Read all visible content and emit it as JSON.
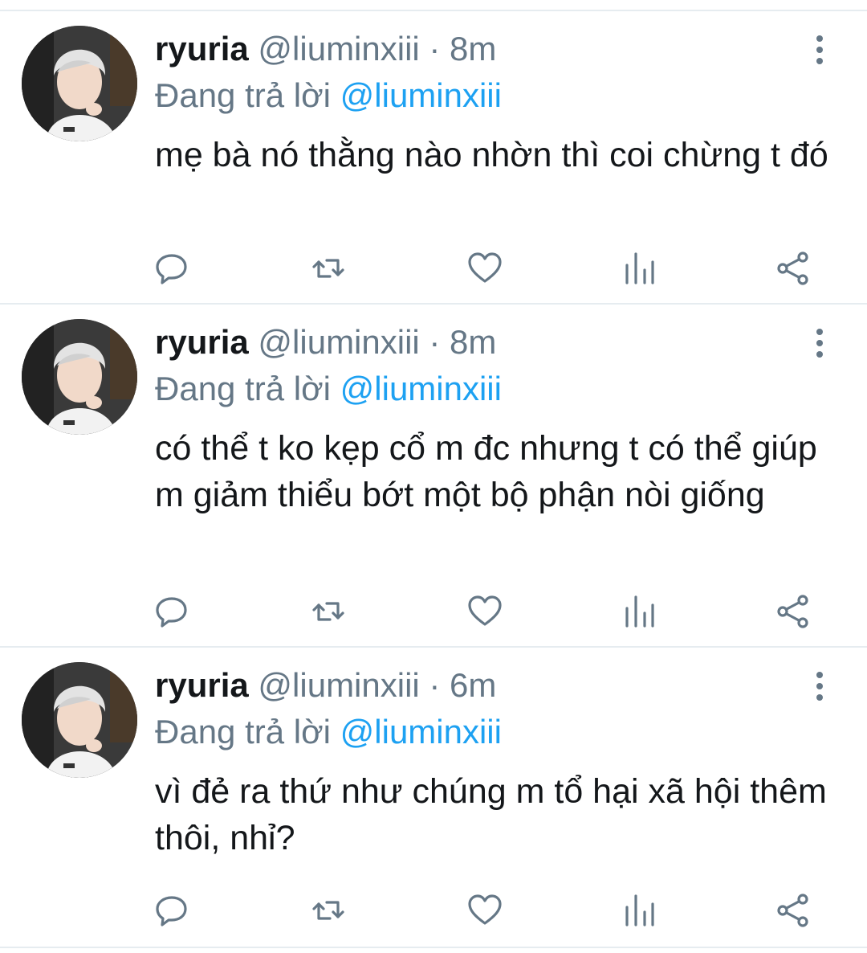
{
  "colors": {
    "text": "#14171a",
    "secondary": "#657786",
    "accent": "#1da1f2",
    "divider": "#e6ecf0",
    "icon": "#657786"
  },
  "icons": {
    "reply": "speech-bubble",
    "retweet": "two-arrows-loop",
    "like": "heart-outline",
    "stats": "bar-chart",
    "share": "share-nodes",
    "more": "vertical-dots"
  },
  "tweets": [
    {
      "display_name": "ryuria",
      "handle_time": "@liuminxiii · 8m",
      "replying_prefix": "Đang trả lời",
      "replying_to": "@liuminxiii",
      "text": "mẹ bà nó thằng nào nhờn thì coi chừng t đó"
    },
    {
      "display_name": "ryuria",
      "handle_time": "@liuminxiii · 8m",
      "replying_prefix": "Đang trả lời",
      "replying_to": "@liuminxiii",
      "text": "có thể t ko kẹp cổ m đc nhưng t có thể giúp m giảm thiểu bớt một bộ phận nòi giống"
    },
    {
      "display_name": "ryuria",
      "handle_time": "@liuminxiii · 6m",
      "replying_prefix": "Đang trả lời",
      "replying_to": "@liuminxiii",
      "text": "vì đẻ ra thứ như chúng m tổ hại xã hội thêm thôi, nhỉ?"
    }
  ]
}
